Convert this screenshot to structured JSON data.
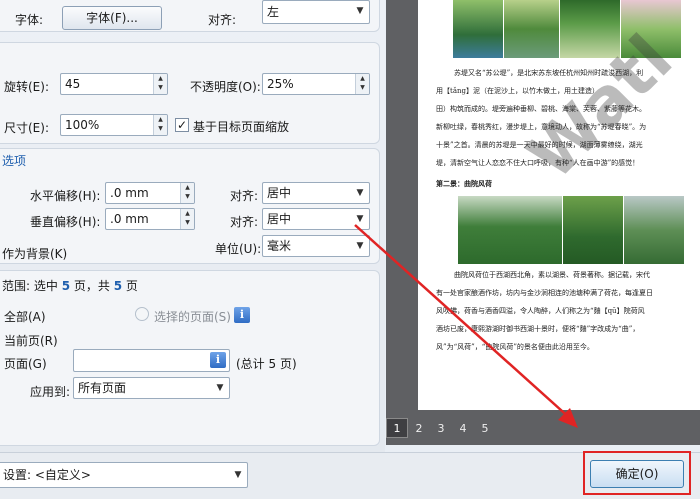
{
  "font": {
    "label": "字体:",
    "button": "字体(F)...",
    "align_label": "对齐:",
    "align_value": "左"
  },
  "transform": {
    "rotate_label": "旋转(E):",
    "rotate_value": "45",
    "opacity_label": "不透明度(O):",
    "opacity_value": "25%",
    "size_label": "尺寸(E):",
    "size_value": "100%",
    "scale_checkbox": "基于目标页面缩放",
    "scale_checked": true
  },
  "position": {
    "section_title": "选项",
    "h_offset_label": "水平偏移(H):",
    "h_offset_value": ".0 mm",
    "h_align_label": "对齐:",
    "h_align_value": "居中",
    "v_offset_label": "垂直偏移(H):",
    "v_offset_value": ".0 mm",
    "v_align_label": "对齐:",
    "v_align_value": "居中",
    "background_label": "作为背景(K)",
    "unit_label": "单位(U):",
    "unit_value": "毫米"
  },
  "range": {
    "title_prefix": "范围: 选中 ",
    "selected": "5",
    "mid": " 页，共 ",
    "total": "5",
    "suffix": " 页",
    "all_label": "全部(A)",
    "selected_pages_label": "选择的页面(S)",
    "current_label": "当前页(R)",
    "pages_label": "页面(G)",
    "pages_value": "",
    "pages_total": "(总计 5 页)",
    "apply_label": "应用到:",
    "apply_value": "所有页面"
  },
  "bottom": {
    "settings_label": "设置: <自定义>",
    "ok_button": "确定(O)"
  },
  "preview": {
    "pages": [
      "1",
      "2",
      "3",
      "4",
      "5"
    ],
    "current_page": "1",
    "watermark": "Watl",
    "para1": [
      "苏堤又名“苏公堤”，是北宋苏东坡任杭州知州时疏浚西湖，利",
      "用【tǎng】泥（在泥沙上，以竹木做土，用土建造）",
      "田）构筑而成的。堤旁遍种垂柳、碧桃、海棠、芙蓉、紫藤等花木。",
      "新柳吐绿，春桃秀红，漫步堤上，意境动人，故称为“苏堤春晓”。为",
      "十景”之首。清晨的苏堤是一天中最好的时候，湖面薄雾缭绕，湖光",
      "堤，清新空气让人恋恋不住大口呼吸，有种“人在画中游”的感觉！"
    ],
    "heading2": "第二景：曲院风荷",
    "para2": [
      "曲院风荷位于西湖西北角，素以湖景、荷景著称。据记载，宋代",
      "有一处官家酿酒作坊，坊内与金沙涧相连的池塘种满了荷花，每逢夏日",
      "风吹拂，荷香与酒香四溢，令人陶醉，人们称之为“麯【qū】院荷风",
      "酒坊已废，康熙游湖时御书西湖十景时，便将“麯”字改成为“曲”，",
      "风”为“风荷”，“曲院风荷”的景名便由此沿用至今。"
    ]
  },
  "colors": {
    "accent": "#1f5fae",
    "highlight": "#e02424"
  }
}
